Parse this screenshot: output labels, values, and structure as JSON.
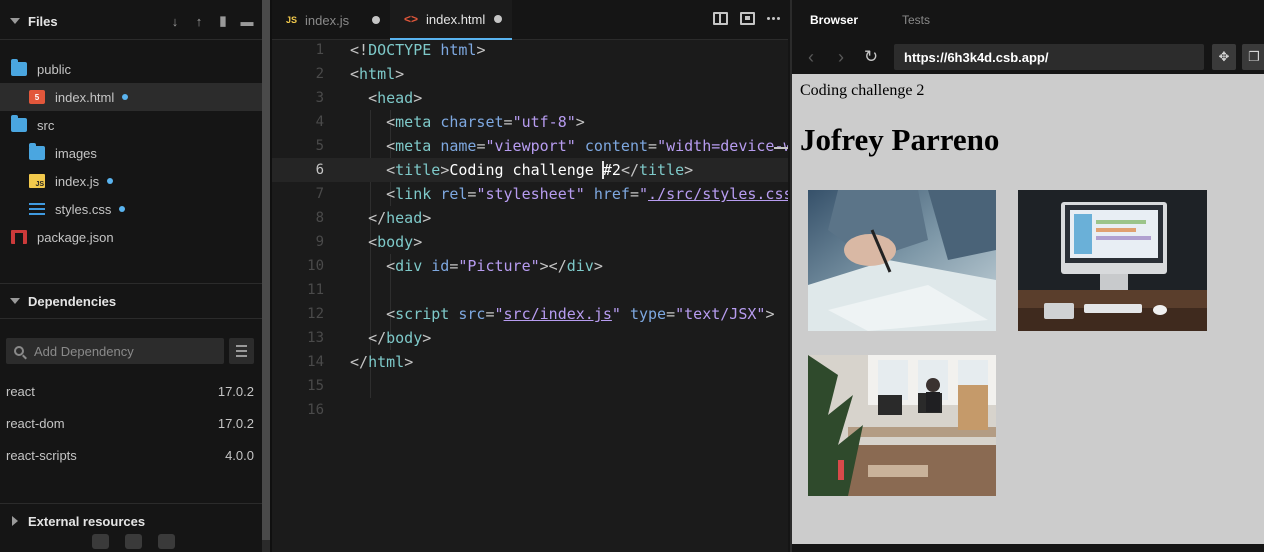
{
  "sidebar": {
    "files_header": "Files",
    "tree": [
      {
        "label": "public",
        "type": "folder"
      },
      {
        "label": "index.html",
        "type": "html",
        "selected": true,
        "modified": true
      },
      {
        "label": "src",
        "type": "folder"
      },
      {
        "label": "images",
        "type": "folder"
      },
      {
        "label": "index.js",
        "type": "js",
        "modified": true
      },
      {
        "label": "styles.css",
        "type": "css",
        "modified": true
      },
      {
        "label": "package.json",
        "type": "json"
      }
    ],
    "dependencies_header": "Dependencies",
    "add_dependency_placeholder": "Add Dependency",
    "dependencies": [
      {
        "name": "react",
        "version": "17.0.2"
      },
      {
        "name": "react-dom",
        "version": "17.0.2"
      },
      {
        "name": "react-scripts",
        "version": "4.0.0"
      }
    ],
    "external_header": "External resources"
  },
  "editor": {
    "tabs": [
      {
        "label": "index.js",
        "icon": "JS",
        "active": false
      },
      {
        "label": "index.html",
        "icon": "<>",
        "active": true
      }
    ],
    "current_line": 6,
    "line_numbers": [
      "1",
      "2",
      "3",
      "4",
      "5",
      "6",
      "7",
      "8",
      "9",
      "10",
      "11",
      "12",
      "13",
      "14",
      "15",
      "16"
    ]
  },
  "browser": {
    "tabs": [
      "Browser",
      "Tests"
    ],
    "url": "https://6h3k4d.csb.app/",
    "page_title": "Coding challenge 2",
    "heading": "Jofrey Parreno"
  },
  "colors": {
    "accent": "#5ab4f0",
    "html_icon": "#e2573b",
    "js_icon": "#f2c94c",
    "tag_name": "#7ec9c9",
    "attr_name": "#7ea8e0",
    "string": "#b79cf0"
  }
}
